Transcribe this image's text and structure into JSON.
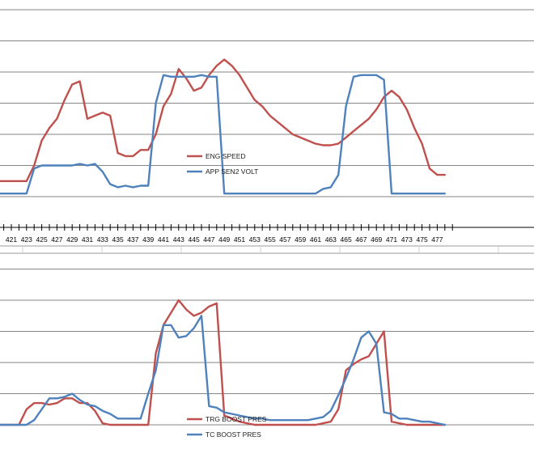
{
  "chart_data": [
    {
      "type": "line",
      "grid": true,
      "legend_position": "center-left",
      "series": [
        {
          "name": "ENG SPEED",
          "color": "#c0504d",
          "x": [
            419,
            421,
            423,
            424,
            425,
            426,
            427,
            428,
            429,
            430,
            431,
            432,
            433,
            434,
            435,
            436,
            437,
            438,
            439,
            440,
            441,
            442,
            443,
            444,
            445,
            446,
            447,
            448,
            449,
            450,
            451,
            452,
            453,
            454,
            455,
            456,
            457,
            458,
            459,
            460,
            461,
            462,
            463,
            464,
            465,
            466,
            467,
            468,
            469,
            470,
            471,
            472,
            473,
            474,
            475,
            476,
            477,
            478
          ],
          "values": [
            0.5,
            0.5,
            0.5,
            1.0,
            1.8,
            2.2,
            2.5,
            3.1,
            3.6,
            3.7,
            2.5,
            2.6,
            2.7,
            2.6,
            1.4,
            1.3,
            1.3,
            1.5,
            1.5,
            2.0,
            2.9,
            3.3,
            4.1,
            3.8,
            3.4,
            3.5,
            3.9,
            4.2,
            4.4,
            4.2,
            3.9,
            3.5,
            3.1,
            2.9,
            2.6,
            2.4,
            2.2,
            2.0,
            1.9,
            1.8,
            1.7,
            1.65,
            1.65,
            1.7,
            1.9,
            2.1,
            2.3,
            2.5,
            2.8,
            3.2,
            3.4,
            3.2,
            2.8,
            2.2,
            1.7,
            0.9,
            0.7,
            0.7
          ]
        },
        {
          "name": "APP SEN2 VOLT",
          "color": "#4f81bd",
          "x": [
            419,
            421,
            423,
            424,
            425,
            426,
            427,
            428,
            429,
            430,
            431,
            432,
            433,
            434,
            435,
            436,
            437,
            438,
            439,
            440,
            441,
            442,
            443,
            444,
            445,
            446,
            447,
            448,
            449,
            450,
            461,
            462,
            463,
            464,
            465,
            466,
            467,
            468,
            469,
            470,
            471,
            472,
            478
          ],
          "values": [
            0.1,
            0.1,
            0.1,
            0.9,
            1.0,
            1.0,
            1.0,
            1.0,
            1.0,
            1.05,
            1.0,
            1.05,
            0.8,
            0.4,
            0.3,
            0.35,
            0.3,
            0.35,
            0.35,
            3.0,
            3.9,
            3.85,
            3.85,
            3.85,
            3.85,
            3.9,
            3.85,
            3.85,
            0.1,
            0.1,
            0.1,
            0.25,
            0.3,
            0.7,
            2.9,
            3.85,
            3.9,
            3.9,
            3.9,
            3.75,
            0.1,
            0.1,
            0.1
          ]
        }
      ],
      "ylim": [
        0,
        6
      ],
      "x_ticks": [
        "421",
        "423",
        "425",
        "427",
        "429",
        "431",
        "433",
        "435",
        "437",
        "439",
        "441",
        "443",
        "445",
        "447",
        "449",
        "451",
        "453",
        "455",
        "457",
        "459",
        "461",
        "463",
        "465",
        "467",
        "469",
        "471",
        "473",
        "475",
        "477"
      ]
    },
    {
      "type": "line",
      "grid": true,
      "legend_position": "bottom-center",
      "series": [
        {
          "name": "TRG BOOST PRES",
          "color": "#c0504d",
          "x": [
            419,
            421,
            422,
            423,
            424,
            425,
            426,
            427,
            428,
            429,
            430,
            431,
            432,
            433,
            434,
            435,
            436,
            437,
            438,
            439,
            440,
            441,
            442,
            443,
            444,
            445,
            446,
            447,
            448,
            449,
            450,
            451,
            452,
            453,
            454,
            455,
            456,
            457,
            458,
            459,
            460,
            461,
            462,
            463,
            464,
            465,
            466,
            467,
            468,
            469,
            470,
            471,
            472,
            473,
            474,
            475,
            476,
            477,
            478
          ],
          "values": [
            0.0,
            0.0,
            0.0,
            0.5,
            0.7,
            0.7,
            0.65,
            0.7,
            0.85,
            0.85,
            0.7,
            0.7,
            0.45,
            0.05,
            0.0,
            0.0,
            0.0,
            0.0,
            0.0,
            0.0,
            2.3,
            3.2,
            3.6,
            4.0,
            3.7,
            3.5,
            3.6,
            3.8,
            3.9,
            0.3,
            0.2,
            0.1,
            0.05,
            0.0,
            0.0,
            0.0,
            0.0,
            0.0,
            0.0,
            0.0,
            0.0,
            0.0,
            0.05,
            0.1,
            0.5,
            1.75,
            1.95,
            2.1,
            2.2,
            2.6,
            3.0,
            0.1,
            0.05,
            0.0,
            0.0,
            0.0,
            0.0,
            0.0,
            0.0
          ]
        },
        {
          "name": "TC BOOST PRES",
          "color": "#4f81bd",
          "x": [
            419,
            421,
            422,
            423,
            424,
            425,
            426,
            427,
            428,
            429,
            430,
            431,
            432,
            433,
            434,
            435,
            436,
            437,
            438,
            439,
            440,
            441,
            442,
            443,
            444,
            445,
            446,
            447,
            448,
            449,
            450,
            451,
            452,
            453,
            454,
            455,
            456,
            457,
            458,
            459,
            460,
            461,
            462,
            463,
            464,
            465,
            466,
            467,
            468,
            469,
            470,
            471,
            472,
            473,
            474,
            475,
            476,
            477,
            478
          ],
          "values": [
            0.0,
            0.0,
            0.0,
            0.0,
            0.15,
            0.5,
            0.85,
            0.85,
            0.9,
            1.0,
            0.8,
            0.65,
            0.6,
            0.45,
            0.35,
            0.2,
            0.2,
            0.2,
            0.2,
            1.0,
            1.75,
            3.2,
            3.2,
            2.8,
            2.85,
            3.1,
            3.5,
            0.6,
            0.55,
            0.4,
            0.35,
            0.3,
            0.25,
            0.2,
            0.2,
            0.15,
            0.15,
            0.15,
            0.15,
            0.15,
            0.15,
            0.2,
            0.25,
            0.45,
            0.95,
            1.5,
            2.1,
            2.8,
            3.0,
            2.6,
            0.4,
            0.35,
            0.2,
            0.2,
            0.15,
            0.1,
            0.1,
            0.05,
            0.0
          ]
        }
      ],
      "ylim": [
        0,
        6
      ]
    }
  ]
}
